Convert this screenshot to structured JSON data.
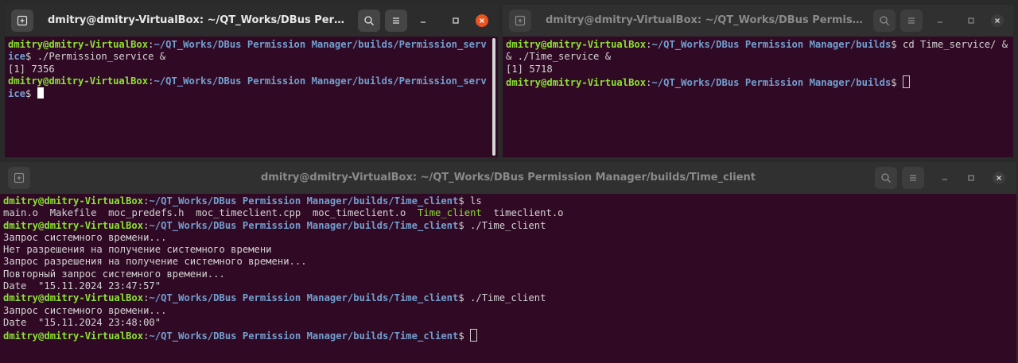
{
  "windows": {
    "left": {
      "title": "dmitry@dmitry-VirtualBox: ~/QT_Works/DBus Permission M...",
      "lines": [
        {
          "user": "dmitry@dmitry-VirtualBox",
          "path": "~/QT_Works/DBus Permission Manager/builds/Permission_service",
          "cmd": " ./Permission_service &"
        },
        {
          "text": "[1] 7356"
        },
        {
          "user": "dmitry@dmitry-VirtualBox",
          "path": "~/QT_Works/DBus Permission Manager/builds/Permission_service",
          "cmd": " "
        }
      ]
    },
    "right": {
      "title": "dmitry@dmitry-VirtualBox: ~/QT_Works/DBus Permission Mana...",
      "lines": [
        {
          "user": "dmitry@dmitry-VirtualBox",
          "path": "~/QT_Works/DBus Permission Manager/builds",
          "cmd": " cd Time_service/ && ./Time_service &"
        },
        {
          "text": "[1] 5718"
        },
        {
          "user": "dmitry@dmitry-VirtualBox",
          "path": "~/QT_Works/DBus Permission Manager/builds",
          "cmd": " "
        }
      ]
    },
    "bottom": {
      "title": "dmitry@dmitry-VirtualBox: ~/QT_Works/DBus Permission Manager/builds/Time_client",
      "lines": [
        {
          "user": "dmitry@dmitry-VirtualBox",
          "path": "~/QT_Works/DBus Permission Manager/builds/Time_client",
          "cmd": " ls"
        },
        {
          "ls": [
            "main.o",
            "Makefile",
            "moc_predefs.h",
            "moc_timeclient.cpp",
            "moc_timeclient.o",
            "Time_client",
            "timeclient.o"
          ],
          "exec": "Time_client"
        },
        {
          "user": "dmitry@dmitry-VirtualBox",
          "path": "~/QT_Works/DBus Permission Manager/builds/Time_client",
          "cmd": " ./Time_client"
        },
        {
          "text": "Запрос системного времени..."
        },
        {
          "text": "Нет разрешения на получение системного времени"
        },
        {
          "text": "Запрос разрешения на получение системного времени..."
        },
        {
          "text": "Повторный запрос системного времени..."
        },
        {
          "text": "Date  \"15.11.2024 23:47:57\""
        },
        {
          "user": "dmitry@dmitry-VirtualBox",
          "path": "~/QT_Works/DBus Permission Manager/builds/Time_client",
          "cmd": " ./Time_client"
        },
        {
          "text": "Запрос системного времени..."
        },
        {
          "text": "Date  \"15.11.2024 23:48:00\""
        },
        {
          "user": "dmitry@dmitry-VirtualBox",
          "path": "~/QT_Works/DBus Permission Manager/builds/Time_client",
          "cmd": " "
        }
      ]
    }
  },
  "icons": {
    "new_tab": "new-tab-icon",
    "search": "search-icon",
    "menu": "hamburger-menu-icon",
    "minimize": "minimize-icon",
    "maximize": "maximize-icon",
    "close": "close-icon"
  },
  "colors": {
    "terminal_bg": "#300a24",
    "user_green": "#8ae234",
    "path_blue": "#729fcf",
    "close_orange": "#e95420"
  }
}
